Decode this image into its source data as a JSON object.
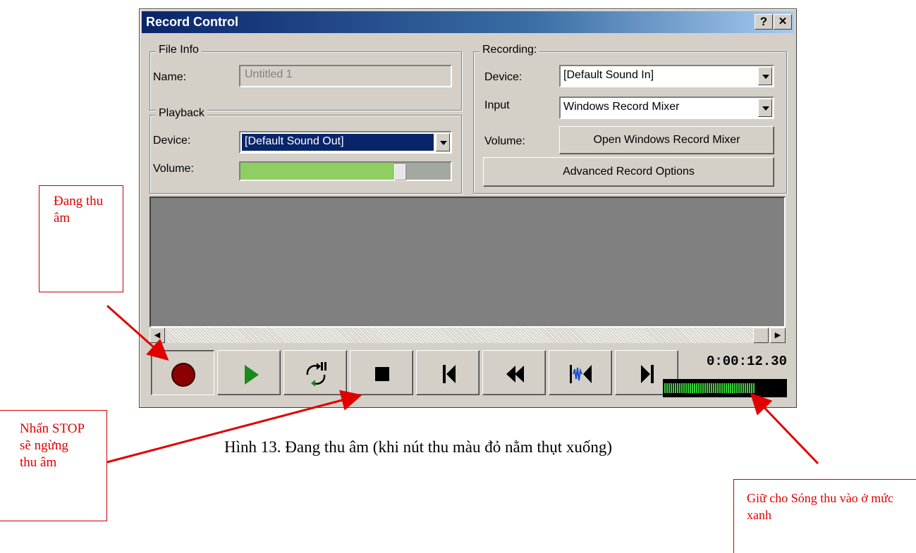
{
  "window": {
    "title": "Record Control",
    "help_label": "?",
    "close_label": "✕"
  },
  "file_info": {
    "legend": "File Info",
    "name_label": "Name:",
    "name_value": "Untitled 1"
  },
  "playback": {
    "legend": "Playback",
    "device_label": "Device:",
    "device_value": "[Default Sound Out]",
    "volume_label": "Volume:",
    "volume_level_percent": 73
  },
  "recording": {
    "legend": "Recording:",
    "device_label": "Device:",
    "device_value": "[Default Sound In]",
    "input_label": "Input",
    "input_value": "Windows Record Mixer",
    "volume_label": "Volume:",
    "open_mixer_label": "Open Windows Record Mixer",
    "advanced_label": "Advanced Record Options"
  },
  "transport": {
    "buttons": [
      "record",
      "play",
      "loop",
      "stop",
      "go-to-start",
      "rewind",
      "seek-marker",
      "go-to-end"
    ],
    "pressed": "record",
    "time": "0:00:12.30",
    "level_percent": 75
  },
  "annotations": {
    "recording_note": "Đang thu âm",
    "stop_note": "Nhấn STOP sẽ ngừng thu âm",
    "level_note": "Giữ cho Sóng thu vào ở mức xanh",
    "caption": "Hình 13. Đang thu âm (khi nút thu màu đỏ nằm thụt xuống)"
  },
  "colors": {
    "annotation": "#e00000",
    "titlebar_start": "#0a246a",
    "record_button": "#8b0000",
    "play_button": "#1a8a1a",
    "level_meter": "#39d139"
  }
}
